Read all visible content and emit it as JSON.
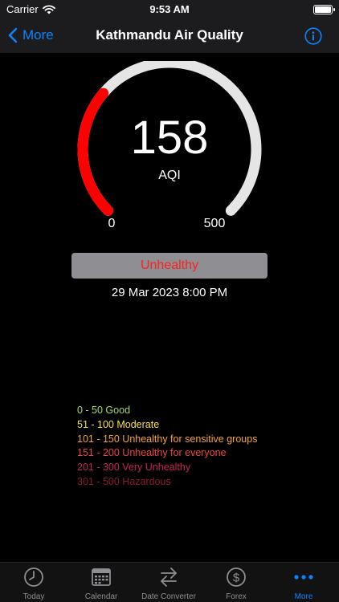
{
  "status_bar": {
    "carrier": "Carrier",
    "time": "9:53 AM",
    "wifi_icon": "wifi-icon",
    "battery_level": 1.0
  },
  "nav": {
    "back_label": "More",
    "title": "Kathmandu Air Quality",
    "info_icon": "info-circle-icon"
  },
  "gauge": {
    "value": "158",
    "unit": "AQI",
    "min_label": "0",
    "max_label": "500",
    "min": 0,
    "max": 500,
    "current": 158,
    "fill_color": "#ff0000",
    "track_color": "#e5e5e5"
  },
  "status": {
    "label": "Unhealthy",
    "timestamp": "29 Mar 2023 8:00 PM"
  },
  "legend": [
    {
      "text": "0 - 50 Good",
      "color": "#a6d96a"
    },
    {
      "text": "51 - 100 Moderate",
      "color": "#f7e14d"
    },
    {
      "text": "101 - 150 Unhealthy for sensitive groups",
      "color": "#f3a33a"
    },
    {
      "text": "151 - 200 Unhealthy for everyone",
      "color": "#ee4444"
    },
    {
      "text": "201 - 300 Very Unhealthy",
      "color": "#c72651"
    },
    {
      "text": "301 - 500 Hazardous",
      "color": "#8c1a2c"
    }
  ],
  "tabs": [
    {
      "label": "Today",
      "icon": "clock-icon"
    },
    {
      "label": "Calendar",
      "icon": "calendar-icon"
    },
    {
      "label": "Date Converter",
      "icon": "arrows-swap-icon"
    },
    {
      "label": "Forex",
      "icon": "dollar-circle-icon"
    },
    {
      "label": "More",
      "icon": "more-dots-icon",
      "active": true
    }
  ]
}
